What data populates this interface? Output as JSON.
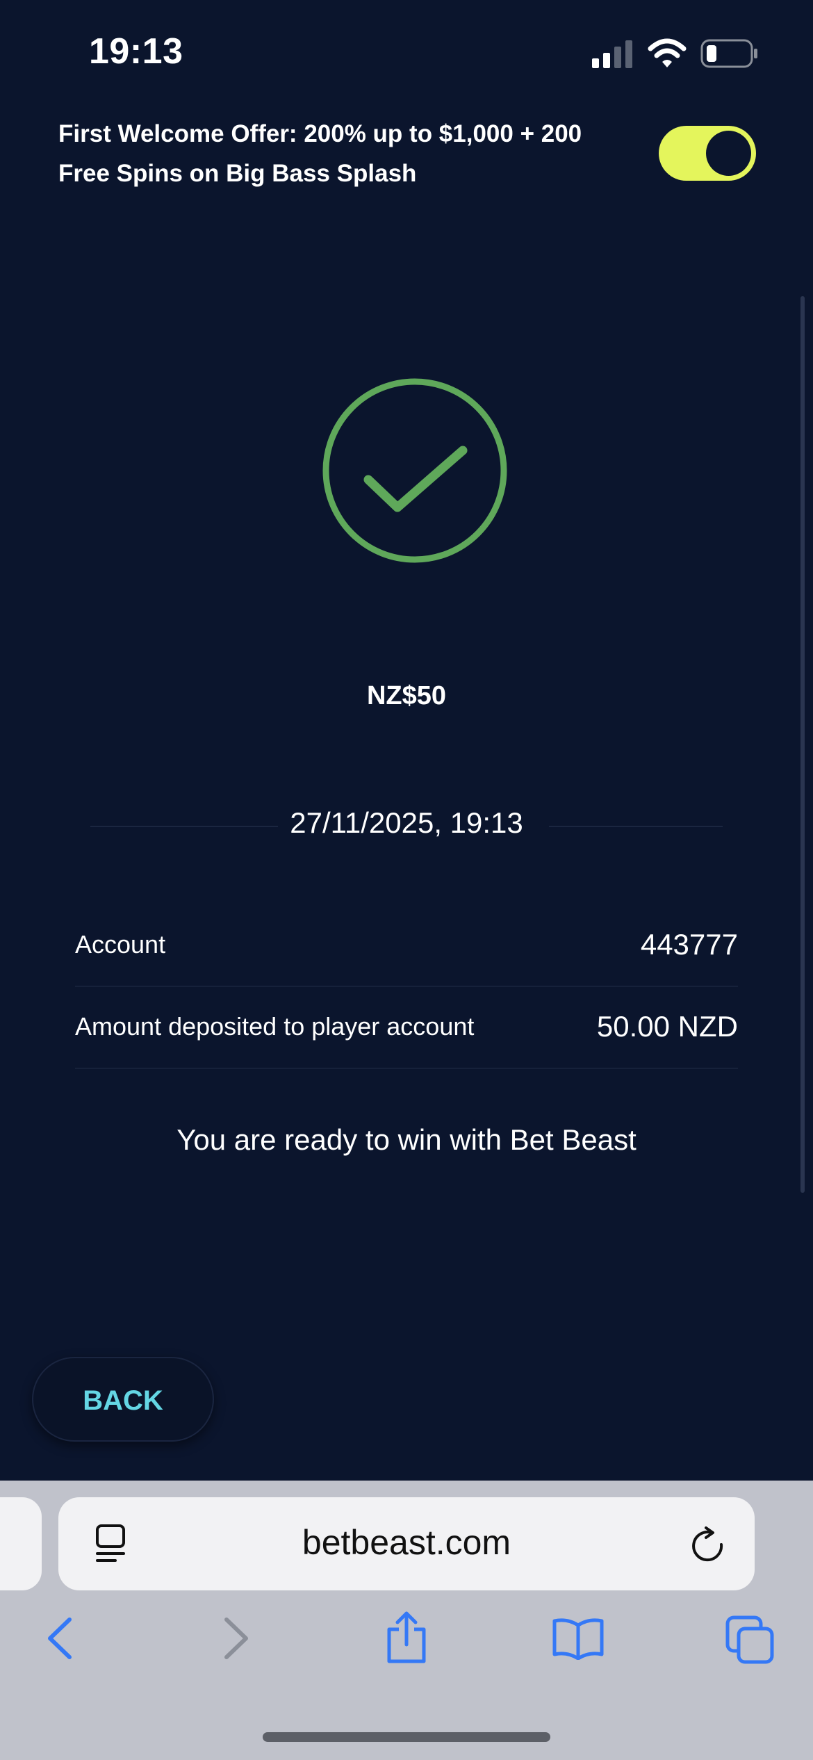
{
  "status_bar": {
    "time": "19:13",
    "icons": [
      "signal-icon",
      "wifi-icon",
      "battery-icon"
    ]
  },
  "offer": {
    "text": "First Welcome Offer: 200% up to $1,000 + 200 Free Spins on Big Bass Splash",
    "toggle_on": true
  },
  "result": {
    "icon": "check-circle-icon",
    "amount": "NZ$50",
    "datetime": "27/11/2025, 19:13",
    "details": [
      {
        "label": "Account",
        "value": "443777"
      },
      {
        "label": "Amount deposited to player account",
        "value": "50.00 NZD"
      }
    ],
    "message": "You are ready to win with Bet Beast"
  },
  "actions": {
    "back_label": "BACK"
  },
  "browser": {
    "address": "betbeast.com",
    "toolbar_icons": [
      "back-icon",
      "forward-icon",
      "share-icon",
      "bookmarks-icon",
      "tabs-icon"
    ]
  },
  "colors": {
    "background": "#0b152d",
    "accent_yellow": "#e4f55c",
    "success_green": "#5fa85a",
    "back_text": "#64d6e4",
    "safari_blue": "#3478f6"
  }
}
